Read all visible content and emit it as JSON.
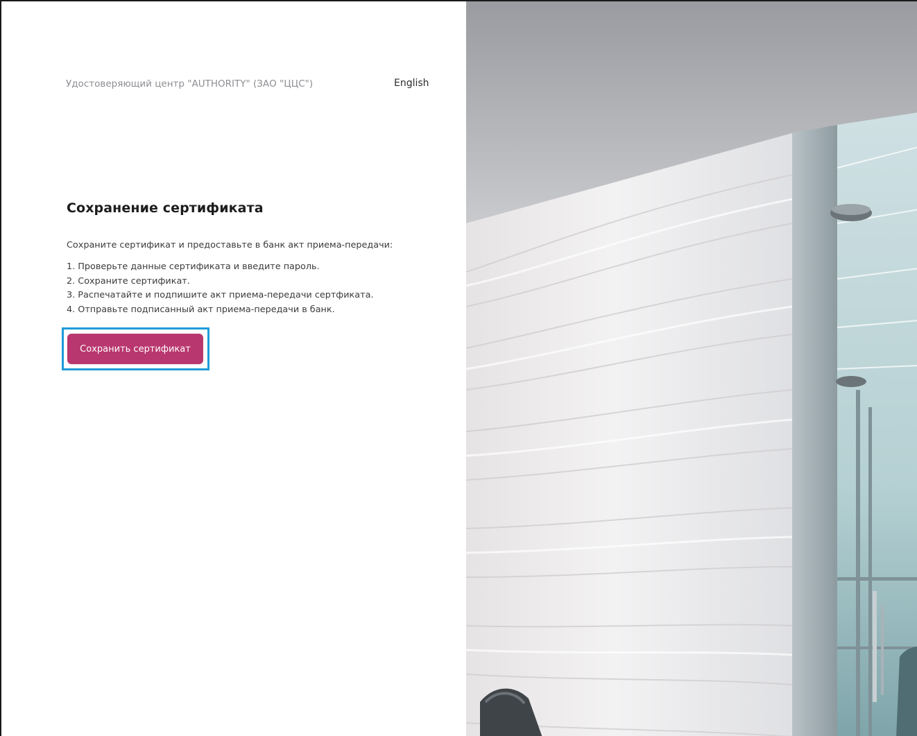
{
  "header": {
    "org_name": "Удостоверяющий центр \"AUTHORITY\" (ЗАО \"ЦЦС\")",
    "language_link": "English"
  },
  "main": {
    "title": "Сохранение сертификата",
    "intro": "Сохраните сертификат и предоставьте в банк акт приема-передачи:",
    "steps": [
      "1. Проверьте данные сертификата и введите пароль.",
      "2. Сохраните сертификат.",
      "3. Распечатайте и подпишите акт приема-передачи сертфиката.",
      "4. Отправьте подписанный акт приема-передачи в банк."
    ],
    "save_button_label": "Сохранить сертификат"
  },
  "colors": {
    "accent": "#b9376f",
    "highlight": "#1e9bd7"
  },
  "background_image": {
    "icon": "office-wall-photo"
  }
}
